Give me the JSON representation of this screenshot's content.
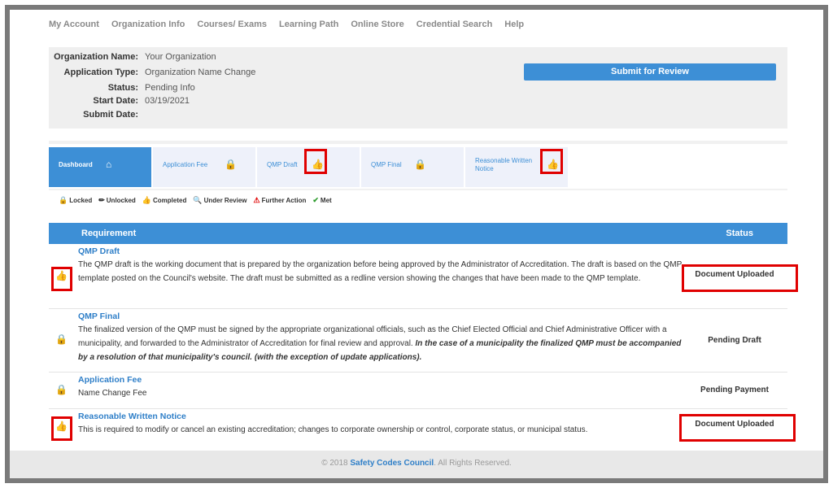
{
  "nav": [
    "My Account",
    "Organization Info",
    "Courses/ Exams",
    "Learning Path",
    "Online Store",
    "Credential Search",
    "Help"
  ],
  "info": {
    "org_name_label": "Organization Name:",
    "org_name": "Your Organization",
    "app_type_label": "Application Type:",
    "app_type": "Organization Name Change",
    "status_label": "Status:",
    "status": "Pending Info",
    "start_label": "Start Date:",
    "start": "03/19/2021",
    "submit_label": "Submit Date:",
    "submit": ""
  },
  "submit_button": "Submit for Review",
  "tabs": [
    {
      "label": "Dashboard",
      "icon": "home-icon"
    },
    {
      "label": "Application Fee",
      "icon": "lock-icon"
    },
    {
      "label": "QMP Draft",
      "icon": "thumbs-up-icon"
    },
    {
      "label": "QMP Final",
      "icon": "lock-icon"
    },
    {
      "label": "Reasonable Written Notice",
      "icon": "thumbs-up-icon"
    }
  ],
  "legend": [
    "Locked",
    "Unlocked",
    "Completed",
    "Under Review",
    "Further Action",
    "Met"
  ],
  "table": {
    "col_requirement": "Requirement",
    "col_status": "Status",
    "rows": [
      {
        "title": "QMP Draft",
        "desc": "The QMP draft is the working document that is prepared by the organization before being approved by the Administrator of Accreditation. The draft is based on the QMP template posted on the Council's website. The draft must be submitted as a redline version showing the changes that have been made to the QMP template.",
        "status": "Document Uploaded",
        "icon": "thumbs-up-icon"
      },
      {
        "title": "QMP Final",
        "desc": "The finalized version of the QMP must be signed by the appropriate organizational officials, such as the Chief Elected Official and Chief Administrative Officer with a municipality, and forwarded to the Administrator of Accreditation for final review and approval.",
        "desc_bold": "In the case of a municipality the finalized QMP must be accompanied by a resolution of that municipality's council. (with the exception of update applications).",
        "status": "Pending Draft",
        "icon": "lock-icon"
      },
      {
        "title": "Application Fee",
        "desc": "Name Change Fee",
        "status": "Pending Payment",
        "icon": "lock-icon"
      },
      {
        "title": "Reasonable Written Notice",
        "desc": "This is required to modify or cancel an existing accreditation; changes to corporate ownership or control, corporate status, or municipal status.",
        "status": "Document Uploaded",
        "icon": "thumbs-up-icon"
      }
    ]
  },
  "footer": {
    "prefix": "© 2018",
    "brand": "Safety Codes Council",
    "suffix": ". All Rights Reserved."
  },
  "colors": {
    "accent": "#3d8fd6",
    "highlight": "#e00000"
  }
}
